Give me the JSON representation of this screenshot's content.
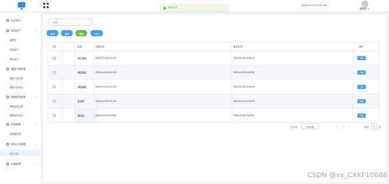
{
  "topbar": {
    "toast_text": "删除成功",
    "datetime": "2024-04-25 13:30:43",
    "username": "管理员 ▾"
  },
  "sidebar": {
    "items": [
      {
        "label": "后台首页",
        "icon": "clock-icon",
        "expanded": false
      },
      {
        "label": "系统用户",
        "icon": "user-icon",
        "expanded": true,
        "children": [
          "管理员",
          "普通用户",
          "教师用户"
        ]
      },
      {
        "label": "课程分类管理",
        "icon": "folder-icon",
        "expanded": true,
        "children": [
          "课程分类列表",
          "课程分类添加"
        ]
      },
      {
        "label": "课程信息管理",
        "icon": "book-icon",
        "expanded": true,
        "children": [
          "课程信息列表",
          "课程信息添加"
        ]
      },
      {
        "label": "系统管理",
        "icon": "gear-icon",
        "expanded": true,
        "children": [
          "轮播图管理"
        ]
      },
      {
        "label": "系统公告管理",
        "icon": "bell-icon",
        "expanded": true,
        "children": [
          "系统公告"
        ]
      },
      {
        "label": "资源管理",
        "icon": "box-icon",
        "expanded": false
      }
    ]
  },
  "main": {
    "search_placeholder": "标题",
    "buttons": [
      {
        "label": "查询",
        "color": "#409eff"
      },
      {
        "label": "新增",
        "color": "#409eff"
      },
      {
        "label": "删除",
        "color": "#67c23a"
      },
      {
        "label": "导出",
        "color": "#409eff"
      }
    ],
    "table": {
      "columns": [
        "标题",
        "创建时间",
        "更新时间",
        "操作"
      ],
      "rows": [
        {
          "title": "快乐通知",
          "created": "2024-04-25 10:21:00",
          "updated": "2024-04-25 14:06:34"
        },
        {
          "title": "课程通知",
          "created": "2024-04-25 10:21:00",
          "updated": "2024-04-25 14:06:33"
        },
        {
          "title": "课程通知",
          "created": "2024-04-25 10:21:00",
          "updated": "2024-04-25 14:06:30"
        },
        {
          "title": "新闻事",
          "created": "2024-04-25 10:21:00",
          "updated": "2024-04-25 10:06:00"
        },
        {
          "title": "通知信",
          "created": "2024-04-25 10:00:00",
          "updated": "2024-04-25 10:00:00"
        }
      ],
      "action_label": "详情"
    },
    "pagination": {
      "total": "共 5 条",
      "page_size": "10条/页",
      "prev": "‹",
      "page": "1",
      "next": "›",
      "goto": "前往",
      "goto_page": "1",
      "page_suffix": "页"
    }
  },
  "watermark": "CSDN @vx_CXKF10088"
}
